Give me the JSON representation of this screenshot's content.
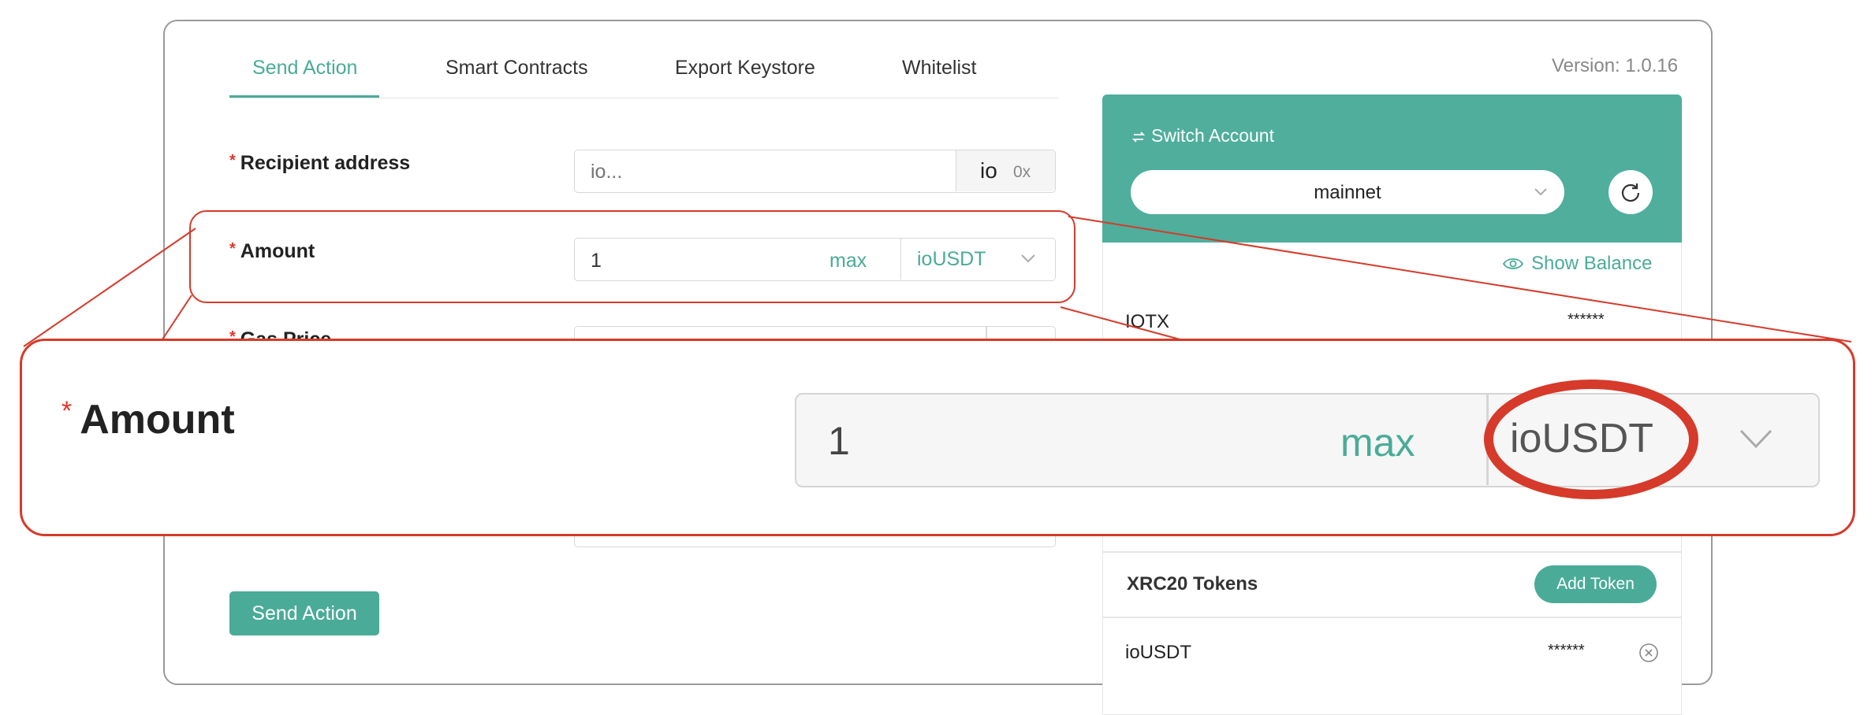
{
  "tabs": [
    {
      "label": "Send Action",
      "active": true
    },
    {
      "label": "Smart Contracts",
      "active": false
    },
    {
      "label": "Export Keystore",
      "active": false
    },
    {
      "label": "Whitelist",
      "active": false
    }
  ],
  "version": "Version: 1.0.16",
  "form": {
    "required_mark": "*",
    "recipient": {
      "label": "Recipient address",
      "placeholder": "io...",
      "addon_io": "io",
      "addon_0x": "0x"
    },
    "amount": {
      "label": "Amount",
      "value": "1",
      "max_label": "max",
      "token": "ioUSDT"
    },
    "gas_price": {
      "label": "Gas Price"
    },
    "submit_label": "Send Action"
  },
  "account": {
    "switch_label": "Switch Account",
    "network": "mainnet",
    "show_balance_label": "Show Balance",
    "balances": [
      {
        "token": "IOTX",
        "value": "******"
      }
    ],
    "xrc20_title": "XRC20 Tokens",
    "add_token_label": "Add Token",
    "tokens": [
      {
        "token": "ioUSDT",
        "value": "******"
      }
    ]
  },
  "zoom": {
    "required_mark": "*",
    "label": "Amount",
    "value": "1",
    "max_label": "max",
    "token": "ioUSDT"
  },
  "colors": {
    "accent": "#4aab98",
    "highlight": "#d63a2a"
  }
}
